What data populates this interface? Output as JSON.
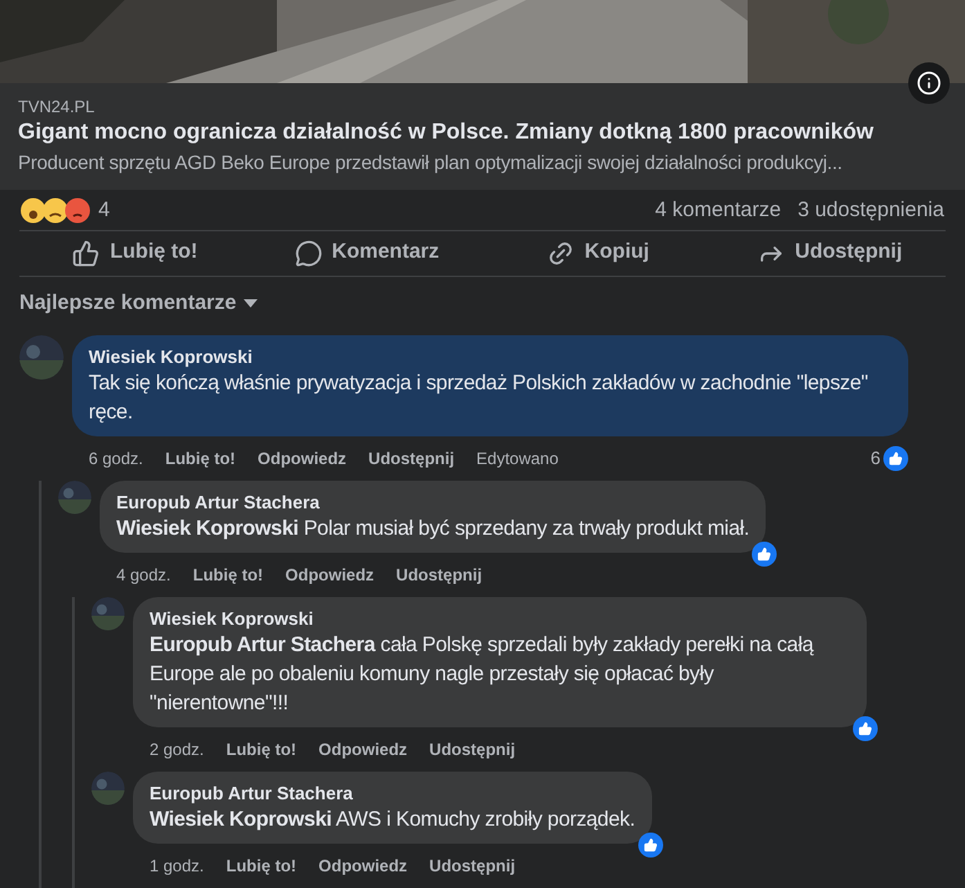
{
  "link_preview": {
    "source": "TVN24.PL",
    "title": "Gigant mocno ogranicza działalność w Polsce. Zmiany dotkną 1800 pracowników",
    "description": "Producent sprzętu AGD Beko Europe przedstawił plan optymalizacji swojej działalności produkcyj..."
  },
  "stats": {
    "reaction_count": "4",
    "comments": "4 komentarze",
    "shares": "3 udostępnienia"
  },
  "actions": [
    {
      "kind": "like",
      "label": "Lubię to!"
    },
    {
      "kind": "comment",
      "label": "Komentarz"
    },
    {
      "kind": "copy",
      "label": "Kopiuj"
    },
    {
      "kind": "share",
      "label": "Udostępnij"
    }
  ],
  "sort": {
    "label": "Najlepsze komentarze"
  },
  "comments": [
    {
      "author": "Wiesiek Koprowski",
      "text": "Tak się kończą właśnie prywatyzacja i sprzedaż Polskich zakładów w zachodnie \"lepsze\" ręce.",
      "highlighted": true,
      "time": "6 godz.",
      "like": "Lubię to!",
      "reply": "Odpowiedz",
      "share": "Udostępnij",
      "edited": "Edytowano",
      "like_count": "6",
      "children": [
        {
          "author": "Europub Artur Stachera",
          "text": "**Wiesiek Koprowski** Polar musiał być sprzedany za trwały produkt miał.",
          "highlighted": false,
          "time": "4 godz.",
          "like": "Lubię to!",
          "reply": "Odpowiedz",
          "share": "Udostępnij",
          "children": [
            {
              "author": "Wiesiek Koprowski",
              "text": "**Europub Artur Stachera** cała Polskę sprzedali były zakłady perełki na całą Europe ale po obaleniu komuny nagle przestały się opłacać były \"nierentowne\"!!!",
              "highlighted": false,
              "time": "2 godz.",
              "like": "Lubię to!",
              "reply": "Odpowiedz",
              "share": "Udostępnij"
            },
            {
              "author": "Europub Artur Stachera",
              "text": "**Wiesiek Koprowski** AWS i Komuchy zrobiły porządek.",
              "highlighted": false,
              "time": "1 godz.",
              "like": "Lubię to!",
              "reply": "Odpowiedz",
              "share": "Udostępnij"
            }
          ]
        }
      ]
    }
  ]
}
